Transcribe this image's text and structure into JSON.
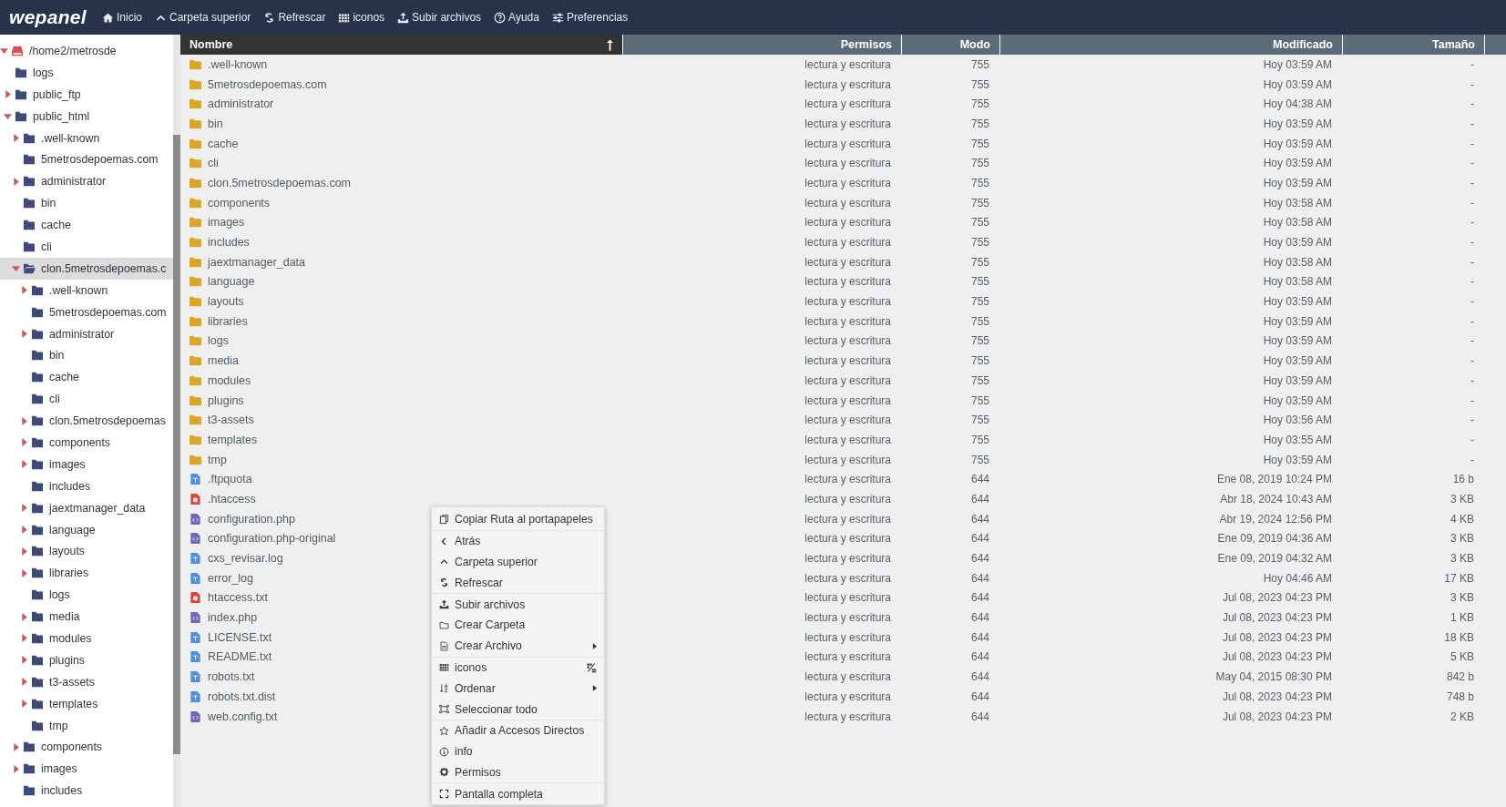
{
  "toolbar": {
    "logo": "wepanel",
    "buttons": [
      {
        "label": "Inicio"
      },
      {
        "label": "Carpeta superior"
      },
      {
        "label": "Refrescar"
      },
      {
        "label": "iconos"
      },
      {
        "label": "Subir archivos"
      },
      {
        "label": "Ayuda"
      },
      {
        "label": "Preferencias"
      }
    ]
  },
  "tree": {
    "label": "/home2/metrosde",
    "expandable": true,
    "expanded": true,
    "selected": false,
    "children": [
      {
        "label": "logs",
        "expandable": false,
        "selected": false
      },
      {
        "label": "public_ftp",
        "expandable": true,
        "expanded": false,
        "selected": false
      },
      {
        "label": "public_html",
        "expandable": true,
        "expanded": true,
        "selected": false,
        "children": [
          {
            "label": ".well-known",
            "expandable": true,
            "expanded": false,
            "selected": false
          },
          {
            "label": "5metrosdepoemas.com",
            "expandable": false,
            "selected": false
          },
          {
            "label": "administrator",
            "expandable": true,
            "expanded": false,
            "selected": false
          },
          {
            "label": "bin",
            "expandable": false,
            "selected": false
          },
          {
            "label": "cache",
            "expandable": false,
            "selected": false
          },
          {
            "label": "cli",
            "expandable": false,
            "selected": false
          },
          {
            "label": "clon.5metrosdepoemas.c",
            "expandable": true,
            "expanded": true,
            "selected": true,
            "children": [
              {
                "label": ".well-known",
                "expandable": true,
                "expanded": false,
                "selected": false
              },
              {
                "label": "5metrosdepoemas.com",
                "expandable": false,
                "selected": false
              },
              {
                "label": "administrator",
                "expandable": true,
                "expanded": false,
                "selected": false
              },
              {
                "label": "bin",
                "expandable": false,
                "selected": false
              },
              {
                "label": "cache",
                "expandable": false,
                "selected": false
              },
              {
                "label": "cli",
                "expandable": false,
                "selected": false
              },
              {
                "label": "clon.5metrosdepoemas",
                "expandable": true,
                "expanded": false,
                "selected": false
              },
              {
                "label": "components",
                "expandable": true,
                "expanded": false,
                "selected": false
              },
              {
                "label": "images",
                "expandable": true,
                "expanded": false,
                "selected": false
              },
              {
                "label": "includes",
                "expandable": false,
                "selected": false
              },
              {
                "label": "jaextmanager_data",
                "expandable": true,
                "expanded": false,
                "selected": false
              },
              {
                "label": "language",
                "expandable": true,
                "expanded": false,
                "selected": false
              },
              {
                "label": "layouts",
                "expandable": true,
                "expanded": false,
                "selected": false
              },
              {
                "label": "libraries",
                "expandable": true,
                "expanded": false,
                "selected": false
              },
              {
                "label": "logs",
                "expandable": false,
                "selected": false
              },
              {
                "label": "media",
                "expandable": true,
                "expanded": false,
                "selected": false
              },
              {
                "label": "modules",
                "expandable": true,
                "expanded": false,
                "selected": false
              },
              {
                "label": "plugins",
                "expandable": true,
                "expanded": false,
                "selected": false
              },
              {
                "label": "t3-assets",
                "expandable": true,
                "expanded": false,
                "selected": false
              },
              {
                "label": "templates",
                "expandable": true,
                "expanded": false,
                "selected": false
              },
              {
                "label": "tmp",
                "expandable": false,
                "selected": false
              }
            ]
          },
          {
            "label": "components",
            "expandable": true,
            "expanded": false,
            "selected": false
          },
          {
            "label": "images",
            "expandable": true,
            "expanded": false,
            "selected": false
          },
          {
            "label": "includes",
            "expandable": false,
            "selected": false
          }
        ]
      }
    ]
  },
  "table": {
    "columns": [
      {
        "label": "Nombre",
        "sorted": true
      },
      {
        "label": "Permisos",
        "sorted": false
      },
      {
        "label": "Modo",
        "sorted": false
      },
      {
        "label": "Modificado",
        "sorted": false
      },
      {
        "label": "Tamaño",
        "sorted": false
      }
    ],
    "rows": [
      {
        "kind": "folder",
        "name": ".well-known",
        "permisos": "lectura y escritura",
        "modo": "755",
        "modificado": "Hoy 03:59 AM",
        "tamano": "-"
      },
      {
        "kind": "folder",
        "name": "5metrosdepoemas.com",
        "permisos": "lectura y escritura",
        "modo": "755",
        "modificado": "Hoy 03:59 AM",
        "tamano": "-"
      },
      {
        "kind": "folder",
        "name": "administrator",
        "permisos": "lectura y escritura",
        "modo": "755",
        "modificado": "Hoy 04:38 AM",
        "tamano": "-"
      },
      {
        "kind": "folder",
        "name": "bin",
        "permisos": "lectura y escritura",
        "modo": "755",
        "modificado": "Hoy 03:59 AM",
        "tamano": "-"
      },
      {
        "kind": "folder",
        "name": "cache",
        "permisos": "lectura y escritura",
        "modo": "755",
        "modificado": "Hoy 03:59 AM",
        "tamano": "-"
      },
      {
        "kind": "folder",
        "name": "cli",
        "permisos": "lectura y escritura",
        "modo": "755",
        "modificado": "Hoy 03:59 AM",
        "tamano": "-"
      },
      {
        "kind": "folder",
        "name": "clon.5metrosdepoemas.com",
        "permisos": "lectura y escritura",
        "modo": "755",
        "modificado": "Hoy 03:59 AM",
        "tamano": "-"
      },
      {
        "kind": "folder",
        "name": "components",
        "permisos": "lectura y escritura",
        "modo": "755",
        "modificado": "Hoy 03:58 AM",
        "tamano": "-"
      },
      {
        "kind": "folder",
        "name": "images",
        "permisos": "lectura y escritura",
        "modo": "755",
        "modificado": "Hoy 03:58 AM",
        "tamano": "-"
      },
      {
        "kind": "folder",
        "name": "includes",
        "permisos": "lectura y escritura",
        "modo": "755",
        "modificado": "Hoy 03:59 AM",
        "tamano": "-"
      },
      {
        "kind": "folder",
        "name": "jaextmanager_data",
        "permisos": "lectura y escritura",
        "modo": "755",
        "modificado": "Hoy 03:58 AM",
        "tamano": "-"
      },
      {
        "kind": "folder",
        "name": "language",
        "permisos": "lectura y escritura",
        "modo": "755",
        "modificado": "Hoy 03:58 AM",
        "tamano": "-"
      },
      {
        "kind": "folder",
        "name": "layouts",
        "permisos": "lectura y escritura",
        "modo": "755",
        "modificado": "Hoy 03:59 AM",
        "tamano": "-"
      },
      {
        "kind": "folder",
        "name": "libraries",
        "permisos": "lectura y escritura",
        "modo": "755",
        "modificado": "Hoy 03:59 AM",
        "tamano": "-"
      },
      {
        "kind": "folder",
        "name": "logs",
        "permisos": "lectura y escritura",
        "modo": "755",
        "modificado": "Hoy 03:59 AM",
        "tamano": "-"
      },
      {
        "kind": "folder",
        "name": "media",
        "permisos": "lectura y escritura",
        "modo": "755",
        "modificado": "Hoy 03:59 AM",
        "tamano": "-"
      },
      {
        "kind": "folder",
        "name": "modules",
        "permisos": "lectura y escritura",
        "modo": "755",
        "modificado": "Hoy 03:59 AM",
        "tamano": "-"
      },
      {
        "kind": "folder",
        "name": "plugins",
        "permisos": "lectura y escritura",
        "modo": "755",
        "modificado": "Hoy 03:59 AM",
        "tamano": "-"
      },
      {
        "kind": "folder",
        "name": "t3-assets",
        "permisos": "lectura y escritura",
        "modo": "755",
        "modificado": "Hoy 03:56 AM",
        "tamano": "-"
      },
      {
        "kind": "folder",
        "name": "templates",
        "permisos": "lectura y escritura",
        "modo": "755",
        "modificado": "Hoy 03:55 AM",
        "tamano": "-"
      },
      {
        "kind": "folder",
        "name": "tmp",
        "permisos": "lectura y escritura",
        "modo": "755",
        "modificado": "Hoy 03:59 AM",
        "tamano": "-"
      },
      {
        "kind": "text",
        "name": ".ftpquota",
        "permisos": "lectura y escritura",
        "modo": "644",
        "modificado": "Ene 08, 2019 10:24 PM",
        "tamano": "16 b"
      },
      {
        "kind": "config",
        "name": ".htaccess",
        "permisos": "lectura y escritura",
        "modo": "644",
        "modificado": "Abr 18, 2024 10:43 AM",
        "tamano": "3 KB"
      },
      {
        "kind": "code",
        "name": "configuration.php",
        "permisos": "lectura y escritura",
        "modo": "644",
        "modificado": "Abr 19, 2024 12:56 PM",
        "tamano": "4 KB"
      },
      {
        "kind": "code",
        "name": "configuration.php-original",
        "permisos": "lectura y escritura",
        "modo": "644",
        "modificado": "Ene 09, 2019 04:36 AM",
        "tamano": "3 KB"
      },
      {
        "kind": "text",
        "name": "cxs_revisar.log",
        "permisos": "lectura y escritura",
        "modo": "644",
        "modificado": "Ene 09, 2019 04:32 AM",
        "tamano": "3 KB"
      },
      {
        "kind": "text",
        "name": "error_log",
        "permisos": "lectura y escritura",
        "modo": "644",
        "modificado": "Hoy 04:46 AM",
        "tamano": "17 KB"
      },
      {
        "kind": "config",
        "name": "htaccess.txt",
        "permisos": "lectura y escritura",
        "modo": "644",
        "modificado": "Jul 08, 2023 04:23 PM",
        "tamano": "3 KB"
      },
      {
        "kind": "code",
        "name": "index.php",
        "permisos": "lectura y escritura",
        "modo": "644",
        "modificado": "Jul 08, 2023 04:23 PM",
        "tamano": "1 KB"
      },
      {
        "kind": "text",
        "name": "LICENSE.txt",
        "permisos": "lectura y escritura",
        "modo": "644",
        "modificado": "Jul 08, 2023 04:23 PM",
        "tamano": "18 KB"
      },
      {
        "kind": "text",
        "name": "README.txt",
        "permisos": "lectura y escritura",
        "modo": "644",
        "modificado": "Jul 08, 2023 04:23 PM",
        "tamano": "5 KB"
      },
      {
        "kind": "text",
        "name": "robots.txt",
        "permisos": "lectura y escritura",
        "modo": "644",
        "modificado": "May 04, 2015 08:30 PM",
        "tamano": "842 b"
      },
      {
        "kind": "text",
        "name": "robots.txt.dist",
        "permisos": "lectura y escritura",
        "modo": "644",
        "modificado": "Jul 08, 2023 04:23 PM",
        "tamano": "748 b"
      },
      {
        "kind": "code",
        "name": "web.config.txt",
        "permisos": "lectura y escritura",
        "modo": "644",
        "modificado": "Jul 08, 2023 04:23 PM",
        "tamano": "2 KB"
      }
    ]
  },
  "context_menu": {
    "items": [
      {
        "label": "Copiar Ruta al portapapeles",
        "group_start": false,
        "submenu": false
      },
      {
        "label": "Atrás",
        "group_start": true,
        "submenu": false
      },
      {
        "label": "Carpeta superior",
        "group_start": false,
        "submenu": false
      },
      {
        "label": "Refrescar",
        "group_start": false,
        "submenu": false
      },
      {
        "label": "Subir archivos",
        "group_start": true,
        "submenu": false
      },
      {
        "label": "Crear Carpeta",
        "group_start": false,
        "submenu": false
      },
      {
        "label": "Crear Archivo",
        "group_start": false,
        "submenu": true
      },
      {
        "label": "iconos",
        "group_start": true,
        "submenu": false
      },
      {
        "label": "Ordenar",
        "group_start": false,
        "submenu": true
      },
      {
        "label": "Seleccionar todo",
        "group_start": false,
        "submenu": false
      },
      {
        "label": "Añadir a Accesos Directos",
        "group_start": true,
        "submenu": false
      },
      {
        "label": "info",
        "group_start": false,
        "submenu": false
      },
      {
        "label": "Permisos",
        "group_start": false,
        "submenu": false
      },
      {
        "label": "Pantalla completa",
        "group_start": true,
        "submenu": false
      }
    ]
  }
}
